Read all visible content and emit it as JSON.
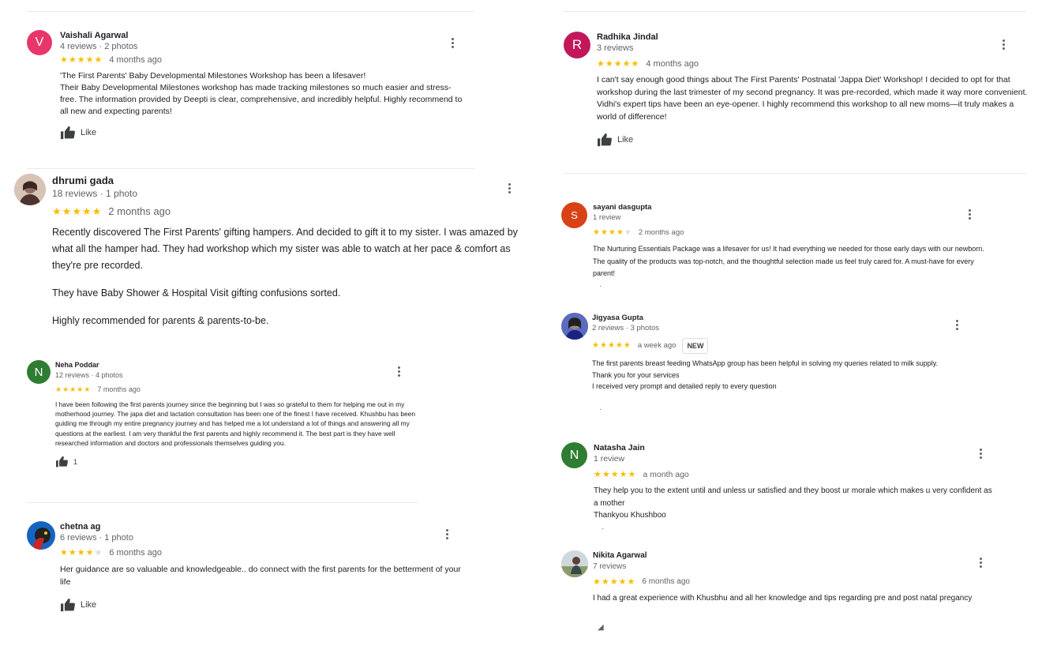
{
  "reviews": {
    "vaishali": {
      "initial": "V",
      "avatar_color": "#e8366b",
      "name": "Vaishali Agarwal",
      "meta": "4 reviews · 2 photos",
      "stars_filled": 5,
      "time": "4 months ago",
      "text": [
        "'The First Parents' Baby Developmental Milestones Workshop has been a lifesaver!",
        "Their Baby Developmental Milestones workshop has made tracking milestones so much easier and stress-free. The information provided by Deepti is clear, comprehensive, and incredibly helpful. Highly recommend to all new and expecting parents!"
      ],
      "like_label": "Like"
    },
    "dhrumi": {
      "name": "dhrumi gada",
      "meta": "18 reviews · 1 photo",
      "stars_filled": 5,
      "time": "2 months ago",
      "text": [
        "Recently discovered The First Parents' gifting hampers. And decided to gift it to my sister. I was amazed by what all the hamper had. They had workshop which my sister was able to watch at her pace & comfort as they're pre recorded.",
        "They have Baby Shower & Hospital Visit gifting confusions sorted.",
        "Highly recommended for parents & parents-to-be."
      ]
    },
    "neha": {
      "initial": "N",
      "avatar_color": "#2e7d32",
      "name": "Neha Poddar",
      "meta": "12 reviews · 4 photos",
      "stars_filled": 5,
      "time": "7 months ago",
      "text": [
        "I have been following the first parents journey since the beginning but I was so grateful to them for helping me out in my motherhood journey. The japa diet and lactation consultation has been one of the finest I have received. Khushbu has been guiding me through my entire pregnancy journey and has helped me a lot understand a lot of things and answering all my questions at the earliest. I am very thankful the first parents and highly recommend it. The best part is they have well researched information and doctors and professionals themselves guiding you."
      ],
      "like_count": "1"
    },
    "chetna": {
      "name": "chetna ag",
      "meta": "6 reviews · 1 photo",
      "stars_filled": 4,
      "time": "6 months ago",
      "text": [
        "Her guidance are so valuable and knowledgeable.. do connect with the first parents for the betterment of your life"
      ],
      "like_label": "Like"
    },
    "radhika": {
      "initial": "R",
      "avatar_color": "#c2185b",
      "name": "Radhika Jindal",
      "meta": "3 reviews",
      "stars_filled": 5,
      "time": "4 months ago",
      "text": [
        "I can't say enough good things about The First Parents' Postnatal 'Jappa Diet' Workshop!  I decided to opt for that workshop during the last trimester of my second pregnancy. It was pre-recorded, which made it way more convenient. Vidhi's expert tips have been an eye-opener. I highly recommend this workshop to all new moms—it truly makes a world of difference!"
      ],
      "like_label": "Like"
    },
    "sayani": {
      "initial": "S",
      "avatar_color": "#d84315",
      "name": "sayani dasgupta",
      "meta": "1 review",
      "stars_filled": 4,
      "time": "2 months ago",
      "text": [
        "The Nurturing Essentials Package was a lifesaver for us! It had everything we needed for those early days with our newborn. The quality of the products was top-notch, and the thoughtful selection made us feel truly cared for. A must-have for every parent!"
      ]
    },
    "jigyasa": {
      "name": "Jigyasa Gupta",
      "meta": "2 reviews · 3 photos",
      "stars_filled": 5,
      "time": "a week ago",
      "badge": "NEW",
      "text": [
        "The first parents breast feeding WhatsApp group has been helpful in solving my queries related to milk supply.",
        "Thank you for your services",
        "I received very prompt and detailed reply to every question"
      ]
    },
    "natasha": {
      "initial": "N",
      "avatar_color": "#2e7d32",
      "name": "Natasha Jain",
      "meta": "1 review",
      "stars_filled": 5,
      "time": "a month ago",
      "text": [
        "They help you to the extent until and unless ur satisfied and they boost ur morale which makes u very confident as a mother",
        "Thankyou Khushboo"
      ]
    },
    "nikita": {
      "name": "Nikita Agarwal",
      "meta": "7 reviews",
      "stars_filled": 5,
      "time": "6 months ago",
      "text": [
        "I had a great experience with Khusbhu and all her knowledge and tips regarding pre and post natal pregancy"
      ]
    }
  },
  "icons": {
    "menu": "more-vert-icon",
    "like": "thumbs-up-icon"
  },
  "colors": {
    "star": "#fbbc04",
    "star_empty": "#dadce0"
  }
}
